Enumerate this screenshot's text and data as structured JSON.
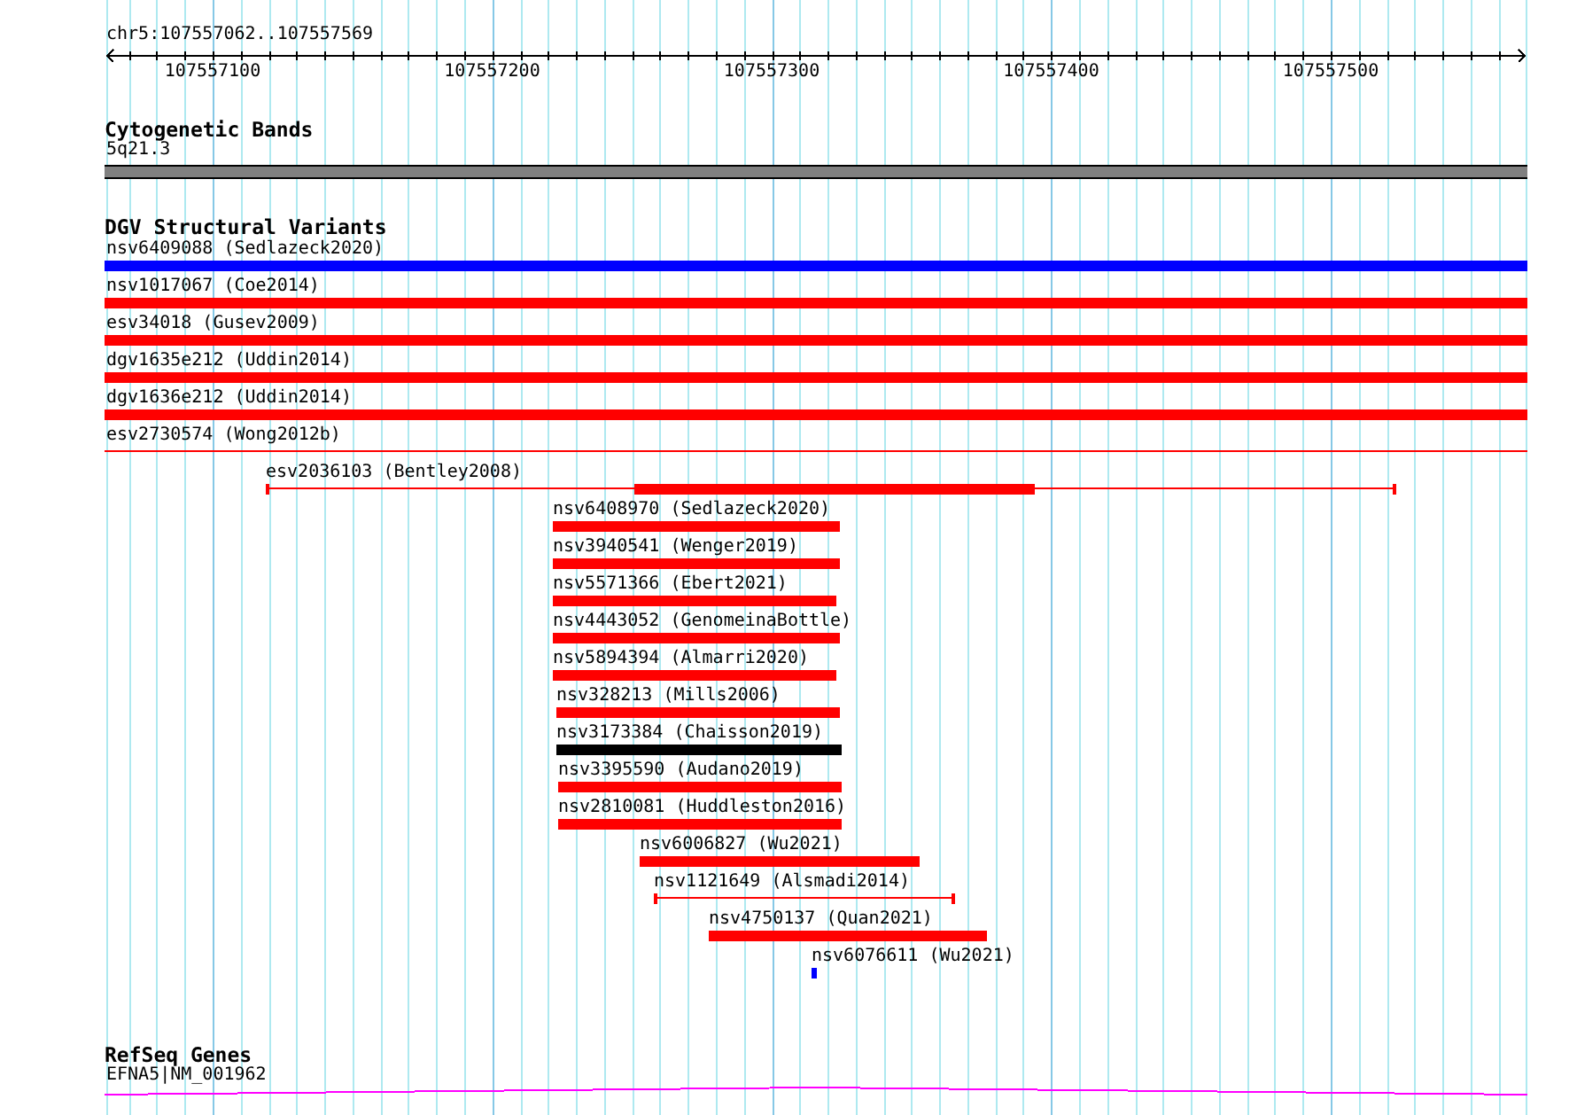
{
  "ruler": {
    "location": "chr5:107557062..107557569",
    "tick_labels": [
      "107557100",
      "107557200",
      "107557300",
      "107557400",
      "107557500"
    ]
  },
  "cytogenetic_bands": {
    "title": "Cytogenetic Bands",
    "band": {
      "label": "5q21.3"
    }
  },
  "dgv_structural_variants": {
    "title": "DGV Structural Variants",
    "variants": [
      {
        "label": "nsv6409088 (Sedlazeck2020)",
        "kind": "bar",
        "color": "#0000ff"
      },
      {
        "label": "nsv1017067 (Coe2014)",
        "kind": "bar",
        "color": "#ff0000"
      },
      {
        "label": "esv34018 (Gusev2009)",
        "kind": "bar",
        "color": "#ff0000"
      },
      {
        "label": "dgv1635e212 (Uddin2014)",
        "kind": "bar",
        "color": "#ff0000"
      },
      {
        "label": "dgv1636e212 (Uddin2014)",
        "kind": "bar",
        "color": "#ff0000"
      },
      {
        "label": "esv2730574 (Wong2012b)",
        "kind": "line",
        "color": "#ff0000"
      },
      {
        "label": "esv2036103 (Bentley2008)",
        "kind": "line-with-bar",
        "color": "#ff0000"
      },
      {
        "label": "nsv6408970 (Sedlazeck2020)",
        "kind": "bar",
        "color": "#ff0000"
      },
      {
        "label": "nsv3940541 (Wenger2019)",
        "kind": "bar",
        "color": "#ff0000"
      },
      {
        "label": "nsv5571366 (Ebert2021)",
        "kind": "bar",
        "color": "#ff0000"
      },
      {
        "label": "nsv4443052 (GenomeinaBottle)",
        "kind": "bar",
        "color": "#ff0000"
      },
      {
        "label": "nsv5894394 (Almarri2020)",
        "kind": "bar",
        "color": "#ff0000"
      },
      {
        "label": "nsv328213 (Mills2006)",
        "kind": "bar",
        "color": "#ff0000"
      },
      {
        "label": "nsv3173384 (Chaisson2019)",
        "kind": "bar",
        "color": "#000000"
      },
      {
        "label": "nsv3395590 (Audano2019)",
        "kind": "bar",
        "color": "#ff0000"
      },
      {
        "label": "nsv2810081 (Huddleston2016)",
        "kind": "bar",
        "color": "#ff0000"
      },
      {
        "label": "nsv6006827 (Wu2021)",
        "kind": "bar",
        "color": "#ff0000"
      },
      {
        "label": "nsv1121649 (Alsmadi2014)",
        "kind": "line",
        "color": "#ff0000"
      },
      {
        "label": "nsv4750137 (Quan2021)",
        "kind": "bar",
        "color": "#ff0000"
      },
      {
        "label": "nsv6076611 (Wu2021)",
        "kind": "bar",
        "color": "#0000ff"
      }
    ]
  },
  "refseq_genes": {
    "title": "RefSeq Genes",
    "gene": {
      "label": "EFNA5|NM_001962"
    }
  }
}
